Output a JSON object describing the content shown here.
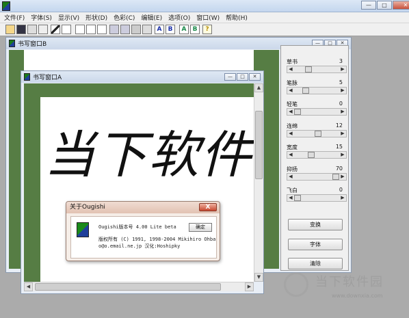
{
  "window": {
    "minimize": "—",
    "maximize": "□",
    "close": "✕"
  },
  "menu": [
    "文件(F)",
    "字体(S)",
    "显示(V)",
    "形状(D)",
    "色彩(C)",
    "编辑(E)",
    "选项(O)",
    "窗口(W)",
    "帮助(H)"
  ],
  "toolbar": {
    "bold_a": "A",
    "bold_b": "B",
    "green_a": "A",
    "green_b": "B",
    "help": "?"
  },
  "windowB": {
    "title": "书写窗口B"
  },
  "windowA": {
    "title": "书写窗口A",
    "handwriting": "当下软件"
  },
  "panel": {
    "sliders": [
      {
        "label": "草书",
        "value": "3",
        "pos": 0.3
      },
      {
        "label": "笔脉",
        "value": "5",
        "pos": 0.25
      },
      {
        "label": "轻笔",
        "value": "0",
        "pos": 0.0
      },
      {
        "label": "连绵",
        "value": "12",
        "pos": 0.45
      },
      {
        "label": "宽度",
        "value": "15",
        "pos": 0.35
      },
      {
        "label": "抑扬",
        "value": "70",
        "pos": 0.82
      },
      {
        "label": "飞白",
        "value": "0",
        "pos": 0.0
      }
    ],
    "buttons": [
      "变换",
      "字体",
      "清除"
    ]
  },
  "about": {
    "title": "关于Ougishi",
    "close": "X",
    "line1": "Ougishi版本号 4.00 Lite beta",
    "line2": "版权所有 (C) 1991, 1998-2004  Mikihiro Ohba",
    "line3": "o@o.email.ne.jp  汉化:Hoshipky",
    "ok": "确定"
  },
  "watermark": {
    "name": "当下软件园",
    "url": "www.downxia.com"
  }
}
